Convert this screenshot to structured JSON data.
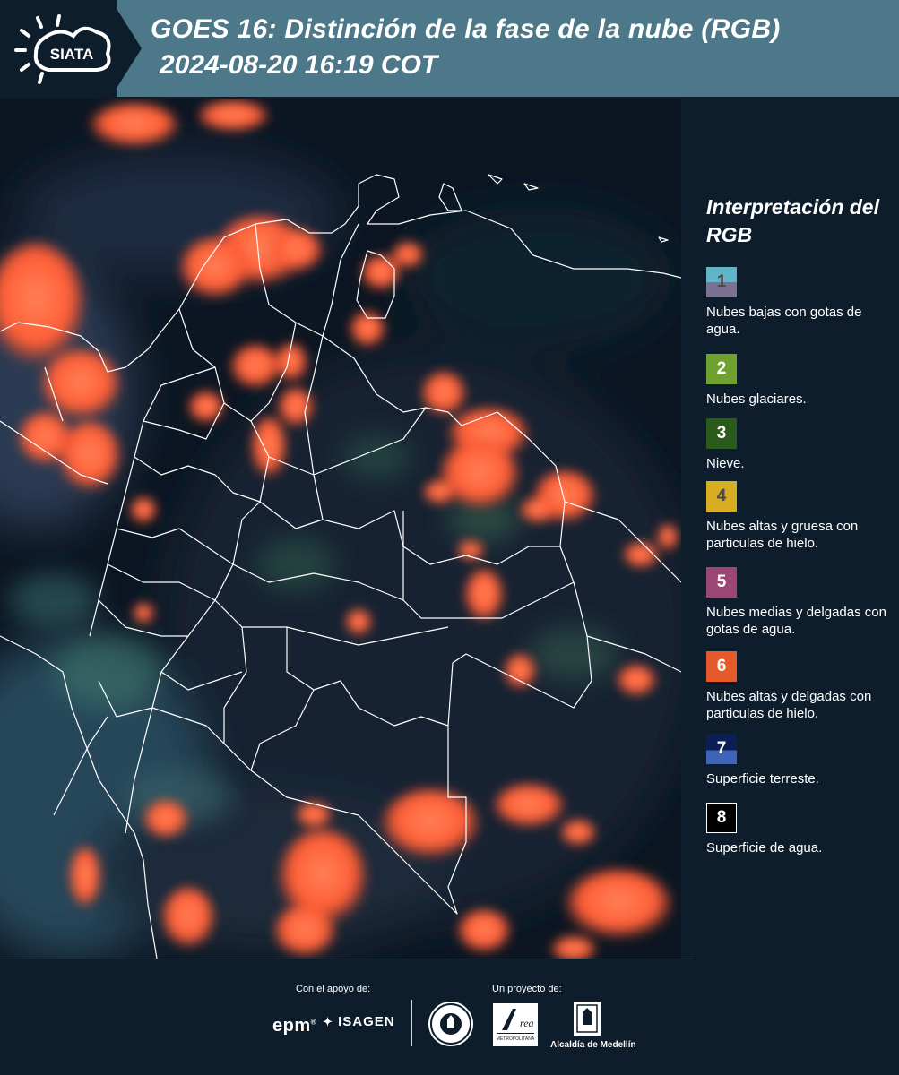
{
  "header": {
    "logo_text": "SIATA",
    "title": "GOES 16: Distinción de la fase de la nube (RGB)",
    "subtitle": "2024-08-20 16:19 COT"
  },
  "legend": {
    "title": "Interpretación del RGB",
    "items": [
      {
        "number": "1",
        "color": "#62b5c8",
        "color2": "#7b7190",
        "text_color": "#4a4a4a",
        "description": "Nubes bajas con gotas de agua."
      },
      {
        "number": "2",
        "color": "#6fa12f",
        "text_color": "#ffffff",
        "description": "Nubes glaciares."
      },
      {
        "number": "3",
        "color": "#2b5a1d",
        "text_color": "#ffffff",
        "description": "Nieve."
      },
      {
        "number": "4",
        "color": "#d7ad21",
        "text_color": "#4a4a4a",
        "description": "Nubes altas y gruesa con particulas de hielo."
      },
      {
        "number": "5",
        "color": "#9a4775",
        "text_color": "#ffffff",
        "description": "Nubes medias y delgadas con gotas de agua."
      },
      {
        "number": "6",
        "color": "#e55a2b",
        "text_color": "#ffffff",
        "description": "Nubes altas y delgadas con particulas de hielo."
      },
      {
        "number": "7",
        "color": "#0b1f55",
        "color2": "#3f63b6",
        "text_color": "#ffffff",
        "description": "Superficie terreste."
      },
      {
        "number": "8",
        "color": "#000000",
        "text_color": "#ffffff",
        "description": "Superficie de agua."
      }
    ]
  },
  "footer": {
    "support_label": "Con el apoyo de:",
    "project_label": "Un proyecto de:",
    "epm": "epm",
    "isagen": "ISAGEN",
    "area_metropolitana": "Área METROPOLITANA Valle de Aburrá",
    "alcaldia": "Alcaldía de Medellín"
  },
  "colors": {
    "background": "#0d1d2b",
    "header_band": "#4d7889",
    "cloud_orange": "#ff6a3d",
    "boundary_line": "#ffffff"
  }
}
